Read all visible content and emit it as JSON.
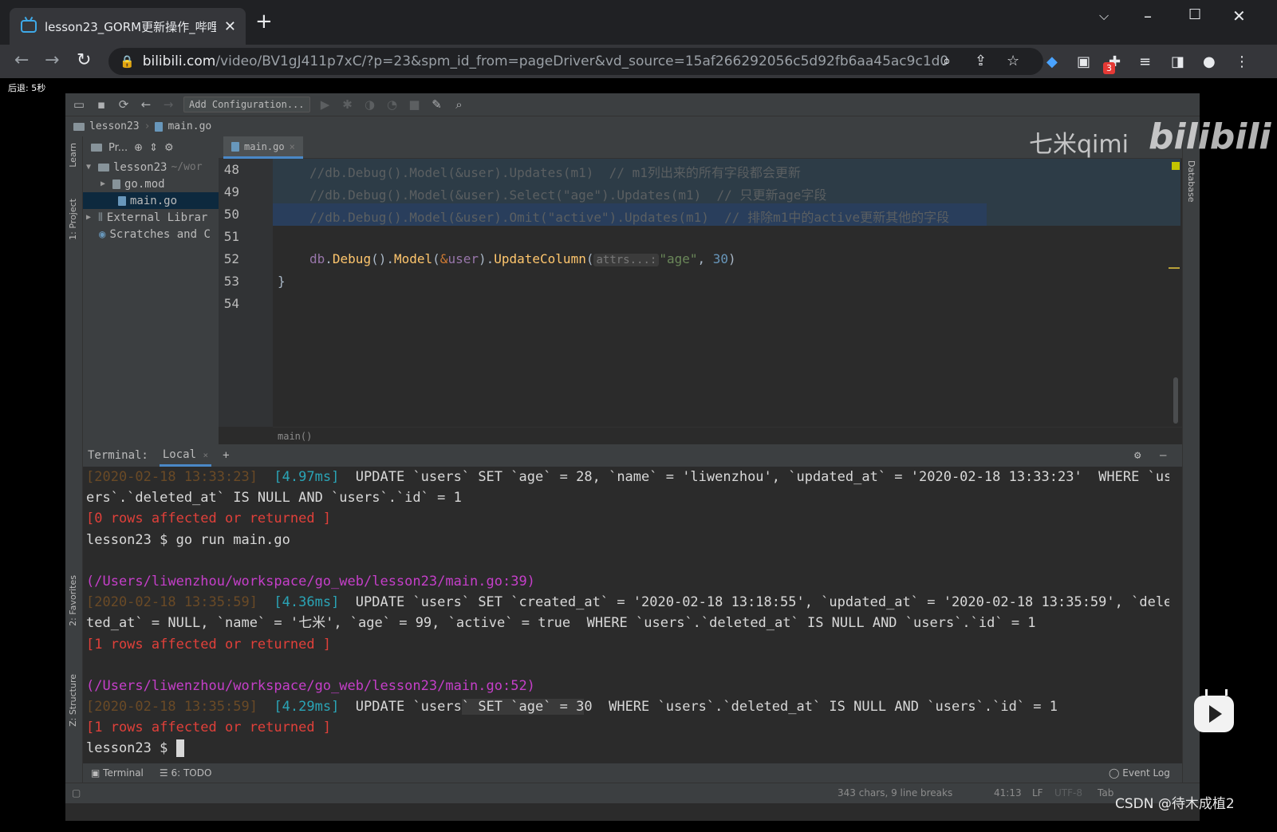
{
  "browser": {
    "tab_title": "lesson23_GORM更新操作_哔哩",
    "tab_close": "✕",
    "new_tab": "+",
    "url_host": "bilibili.com",
    "url_path": "/video/BV1gJ411p7xC/?p=23&spm_id_from=pageDriver&vd_source=15af266292056c5d92fb6aa45ac9c1d0",
    "extension_badge": "3"
  },
  "overlay": {
    "back_hint": "后退: 5秒",
    "watermark_name": "七米qimi",
    "watermark_brand": "bilibili",
    "csdn_credit": "CSDN @待木成植2"
  },
  "ide": {
    "add_configuration": "Add Configuration...",
    "breadcrumb_project": "lesson23",
    "breadcrumb_file": "main.go",
    "left_strip": {
      "learn": "Learn",
      "project": "1: Project",
      "favorites": "2: Favorites",
      "structure": "Z: Structure"
    },
    "right_strip": {
      "database": "Database"
    },
    "project_header": "Pr...",
    "tree": [
      {
        "label": "lesson23",
        "path": "~/wor"
      },
      {
        "label": "go.mod"
      },
      {
        "label": "main.go"
      },
      {
        "label": "External Librar"
      },
      {
        "label": "Scratches and C"
      }
    ],
    "editor_tab": "main.go",
    "line_numbers": [
      "48",
      "49",
      "50",
      "51",
      "52",
      "53",
      "54"
    ],
    "code": {
      "l48": "//db.Debug().Model(&user).Updates(m1)  // m1列出来的所有字段都会更新",
      "l49": "//db.Debug().Model(&user).Select(\"age\").Updates(m1)  // 只更新age字段",
      "l50": "//db.Debug().Model(&user).Omit(\"active\").Updates(m1)  // 排除m1中的active更新其他的字段",
      "l52": {
        "db": "db",
        "dot1": ".",
        "debug": "Debug",
        "paren1": "().",
        "model": "Model",
        "open": "(",
        "amp": "&",
        "user": "user",
        "close": ").",
        "update_column": "UpdateColumn",
        "open2": "(",
        "hint": "attrs...:",
        "arg1": "\"age\"",
        "comma": ", ",
        "arg2": "30",
        "close2": ")"
      },
      "l53": "}"
    },
    "code_breadcrumb": "main()",
    "terminal": {
      "label": "Terminal:",
      "tab": "Local",
      "lines": {
        "l1_ts": "[2020-02-18 13:33:23]",
        "l1_ms": "[4.97ms]",
        "l1_sql": "UPDATE `users` SET `age` = 28, `name` = 'liwenzhou', `updated_at` = '2020-02-18 13:33:23'  WHERE `us",
        "l2": "ers`.`deleted_at` IS NULL AND `users`.`id` = 1",
        "l3": "[0 rows affected or returned ]",
        "l4": "lesson23 $ go run main.go",
        "l6": "(/Users/liwenzhou/workspace/go_web/lesson23/main.go:39)",
        "l7_ts": "[2020-02-18 13:35:59]",
        "l7_ms": "[4.36ms]",
        "l7_sql": "UPDATE `users` SET `created_at` = '2020-02-18 13:18:55', `updated_at` = '2020-02-18 13:35:59', `dele",
        "l8": "ted_at` = NULL, `name` = '七米', `age` = 99, `active` = true  WHERE `users`.`deleted_at` IS NULL AND `users`.`id` = 1",
        "l9": "[1 rows affected or returned ]",
        "l11": "(/Users/liwenzhou/workspace/go_web/lesson23/main.go:52)",
        "l12_ts": "[2020-02-18 13:35:59]",
        "l12_ms": "[4.29ms]",
        "l12_sql_a": "UPDATE `users",
        "l12_sql_sel": "` SET `age` = 3",
        "l12_sql_b": "0  WHERE `users`.`deleted_at` IS NULL AND `users`.`id` = 1",
        "l13": "[1 rows affected or returned ]",
        "l14": "lesson23 $ "
      }
    },
    "bottom_tabs": {
      "terminal": "Terminal",
      "todo": "6: TODO",
      "event_log": "Event Log"
    },
    "status": {
      "chars": "343 chars, 9 line breaks",
      "position": "41:13",
      "line_sep": "LF",
      "encoding": "UTF-8",
      "indent": "Tab"
    }
  }
}
